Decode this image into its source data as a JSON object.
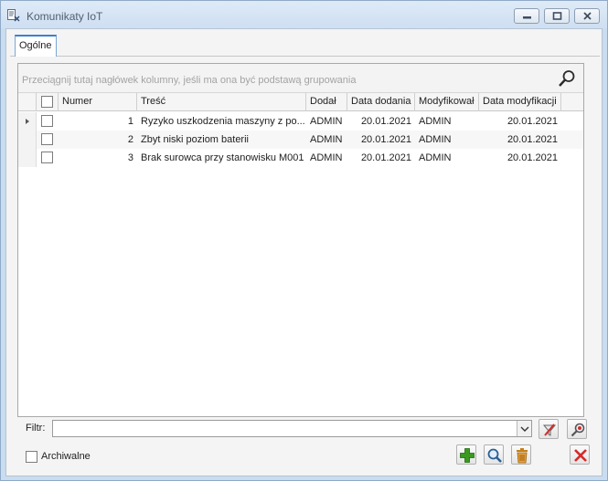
{
  "window": {
    "title": "Komunikaty IoT"
  },
  "tabs": [
    {
      "label": "Ogólne"
    }
  ],
  "grid": {
    "group_hint": "Przeciągnij tutaj nagłówek kolumny, jeśli ma ona być podstawą grupowania",
    "columns": [
      "Numer",
      "Treść",
      "Dodał",
      "Data dodania",
      "Modyfikował",
      "Data modyfikacji"
    ],
    "rows": [
      {
        "numer": "1",
        "tresc": "Ryzyko uszkodzenia maszyny z po...",
        "dodal": "ADMIN",
        "data_dodania": "20.01.2021",
        "modyfikowal": "ADMIN",
        "data_modyfikacji": "20.01.2021"
      },
      {
        "numer": "2",
        "tresc": "Zbyt niski poziom baterii",
        "dodal": "ADMIN",
        "data_dodania": "20.01.2021",
        "modyfikowal": "ADMIN",
        "data_modyfikacji": "20.01.2021"
      },
      {
        "numer": "3",
        "tresc": "Brak surowca przy stanowisku M001",
        "dodal": "ADMIN",
        "data_dodania": "20.01.2021",
        "modyfikowal": "ADMIN",
        "data_modyfikacji": "20.01.2021"
      }
    ]
  },
  "filter": {
    "label": "Filtr:",
    "value": ""
  },
  "archiwalne": {
    "label": "Archiwalne"
  },
  "icons": {
    "search": "search-icon",
    "clear_filter": "clear-filter-icon",
    "filter_settings": "filter-settings-icon",
    "add": "add-icon",
    "preview": "magnifier-icon",
    "delete": "trash-icon",
    "close": "close-icon"
  },
  "colors": {
    "add_green": "#3a9a1f",
    "close_red": "#d42a2a",
    "trash_orange": "#c7801a",
    "tab_accent": "#3b7fcf"
  }
}
